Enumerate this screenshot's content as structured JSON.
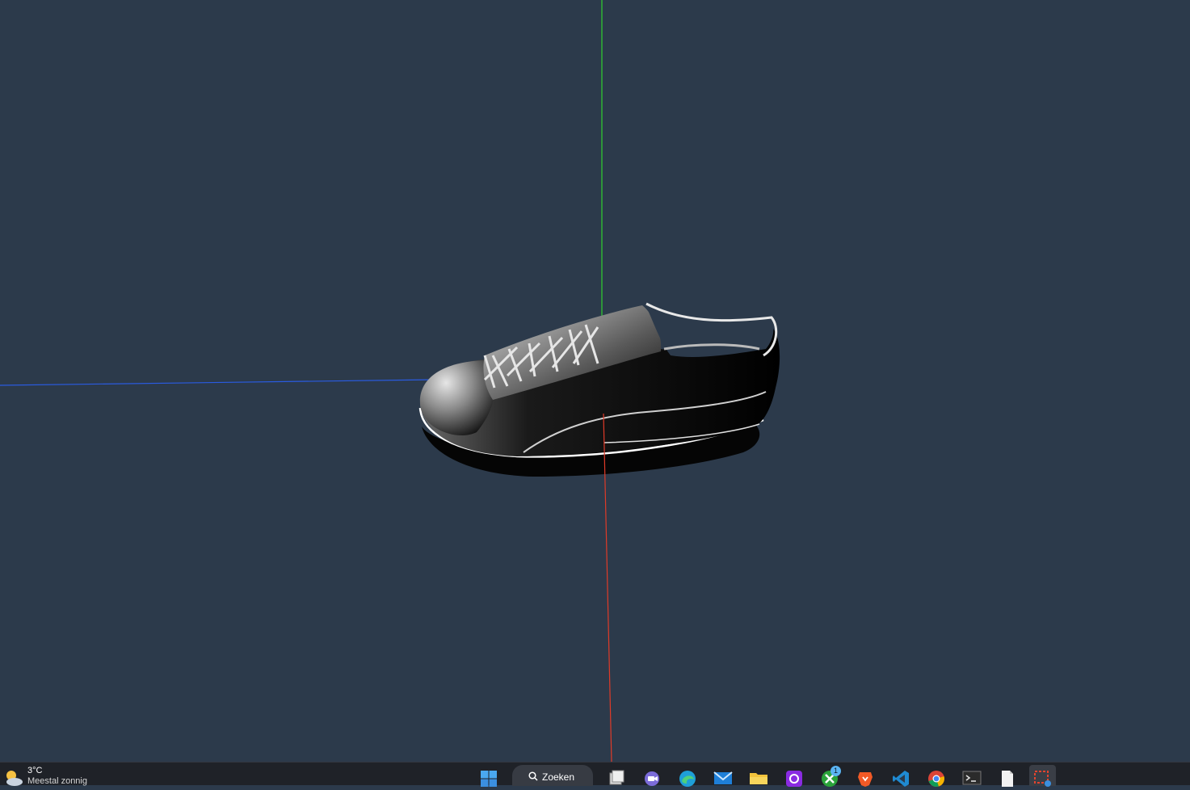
{
  "scene": {
    "object": "sneaker-3d-model",
    "background_color": "#2c3a4b",
    "axes": {
      "x_color": "#e03a28",
      "y_color": "#2fd02f",
      "z_color": "#2a5be0"
    }
  },
  "taskbar": {
    "weather": {
      "temperature": "3°C",
      "description": "Meestal zonnig"
    },
    "search": {
      "label": "Zoeken"
    },
    "apps": [
      {
        "name": "start",
        "icon": "windows-logo-icon"
      },
      {
        "name": "task-view",
        "icon": "task-view-icon"
      },
      {
        "name": "teams",
        "icon": "teams-icon"
      },
      {
        "name": "edge",
        "icon": "edge-icon"
      },
      {
        "name": "mail",
        "icon": "mail-icon"
      },
      {
        "name": "file-explorer",
        "icon": "folder-icon"
      },
      {
        "name": "vpn",
        "icon": "vpn-icon"
      },
      {
        "name": "xbox",
        "icon": "xbox-icon",
        "badge": "1"
      },
      {
        "name": "brave",
        "icon": "brave-icon"
      },
      {
        "name": "vscode",
        "icon": "vscode-icon"
      },
      {
        "name": "chrome",
        "icon": "chrome-icon"
      },
      {
        "name": "terminal",
        "icon": "terminal-icon"
      },
      {
        "name": "notepad",
        "icon": "document-icon"
      },
      {
        "name": "snipping-tool",
        "icon": "snipping-tool-icon",
        "active": true
      }
    ]
  }
}
